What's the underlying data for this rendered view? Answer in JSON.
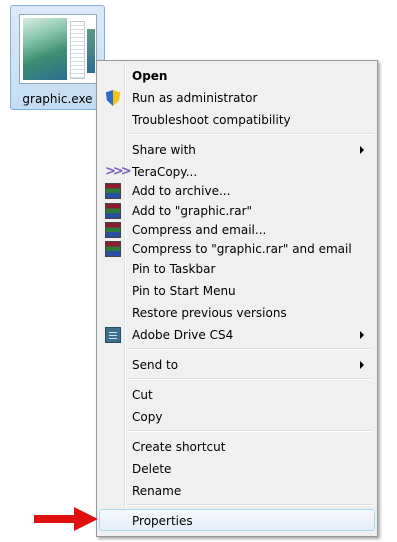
{
  "file": {
    "name": "graphic.exe",
    "icon": "exe-thumbnail-icon"
  },
  "menu": {
    "items": [
      {
        "label": "Open"
      },
      {
        "label": "Run as administrator",
        "icon": "uac-shield-icon"
      },
      {
        "label": "Troubleshoot compatibility"
      },
      {
        "label": "Share with"
      },
      {
        "label": "TeraCopy...",
        "icon": "teracopy-icon"
      },
      {
        "label": "Add to archive...",
        "icon": "winrar-icon"
      },
      {
        "label": "Add to \"graphic.rar\"",
        "icon": "winrar-icon"
      },
      {
        "label": "Compress and email...",
        "icon": "winrar-icon"
      },
      {
        "label": "Compress to \"graphic.rar\" and email",
        "icon": "winrar-icon"
      },
      {
        "label": "Pin to Taskbar"
      },
      {
        "label": "Pin to Start Menu"
      },
      {
        "label": "Restore previous versions"
      },
      {
        "label": "Adobe Drive CS4",
        "icon": "adobe-drive-icon"
      },
      {
        "label": "Send to"
      },
      {
        "label": "Cut"
      },
      {
        "label": "Copy"
      },
      {
        "label": "Create shortcut"
      },
      {
        "label": "Delete"
      },
      {
        "label": "Rename"
      },
      {
        "label": "Properties"
      }
    ]
  },
  "pointer": {
    "icon": "red-arrow-icon",
    "color": "#e01010"
  }
}
